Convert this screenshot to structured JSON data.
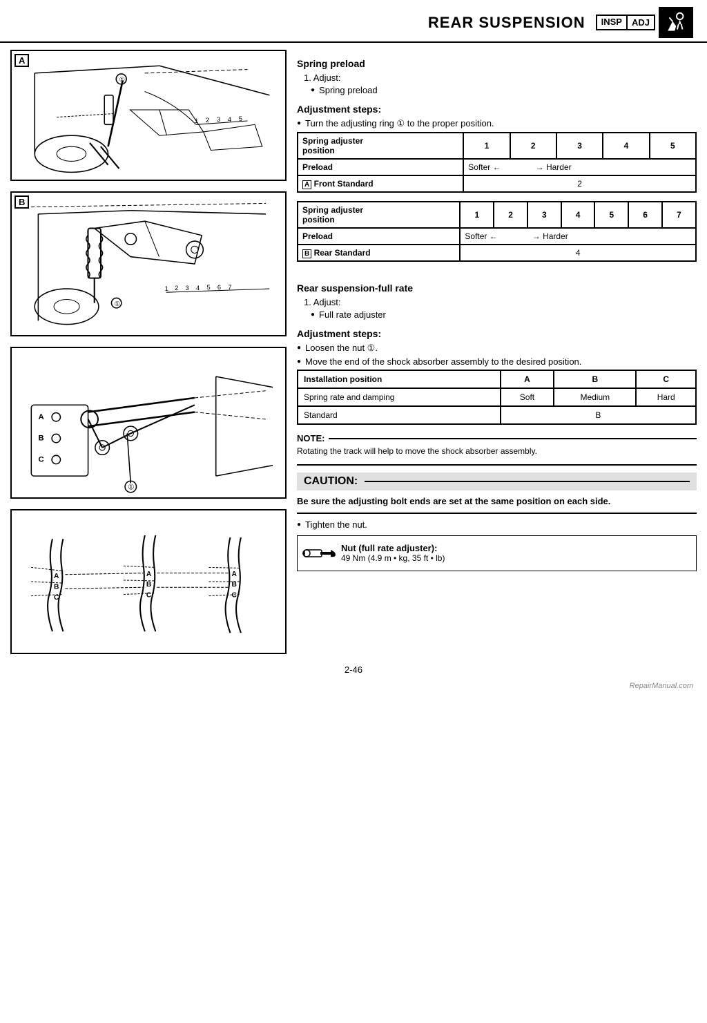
{
  "header": {
    "title": "REAR SUSPENSION",
    "insp": "INSP",
    "adj": "ADJ"
  },
  "section1": {
    "heading": "Spring preload",
    "step": "1. Adjust:",
    "bullet1": "Spring preload",
    "adj_heading": "Adjustment steps:",
    "adj_bullet": "Turn the adjusting ring ① to the proper position."
  },
  "table1": {
    "col_header": "Spring adjuster position",
    "cols": [
      "1",
      "2",
      "3",
      "4",
      "5"
    ],
    "row1_label": "Preload",
    "row1_val": "Softer ←               → Harder",
    "row2_label": "A Front Standard",
    "row2_val": "2"
  },
  "table2": {
    "col_header": "Spring adjuster position",
    "cols": [
      "1",
      "2",
      "3",
      "4",
      "5",
      "6",
      "7"
    ],
    "row1_label": "Preload",
    "row1_val": "Softer ←               → Harder",
    "row2_label": "B Rear Standard",
    "row2_val": "4"
  },
  "section2": {
    "heading": "Rear suspension-full rate",
    "step": "1. Adjust:",
    "bullet1": "Full rate adjuster",
    "adj_heading": "Adjustment steps:",
    "adj_bullet1": "Loosen the nut ①.",
    "adj_bullet2": "Move the end of the shock absorber assembly to the desired position."
  },
  "table3": {
    "header_col1": "Installation position",
    "header_col2": "A",
    "header_col3": "B",
    "header_col4": "C",
    "row1_label": "Spring rate and damping",
    "row1_c2": "Soft",
    "row1_c3": "Medium",
    "row1_c4": "Hard",
    "row2_label": "Standard",
    "row2_val": "B"
  },
  "note": {
    "label": "NOTE:",
    "text": "Rotating the track will help to move the shock absorber assembly."
  },
  "caution": {
    "label": "CAUTION:",
    "text": "Be sure the adjusting bolt ends are set at the same position on each side.",
    "bullet": "Tighten the nut."
  },
  "torque": {
    "label": "Nut (full rate adjuster):",
    "value": "49 Nm (4.9 m • kg, 35 ft • lb)"
  },
  "page": {
    "number": "2-46"
  },
  "watermark": "RepairManual.com"
}
